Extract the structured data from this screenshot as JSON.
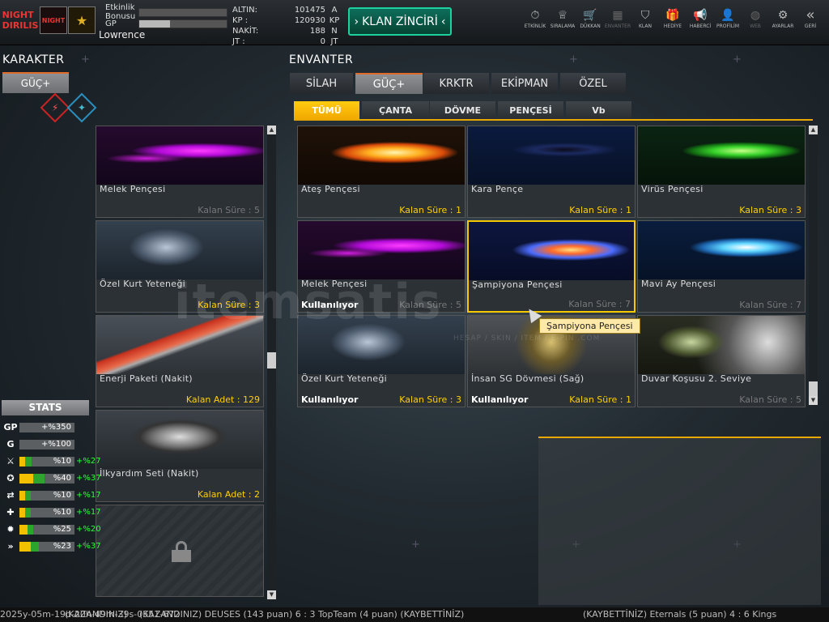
{
  "topbar": {
    "logos": [
      "NIGHT\nDIRILIS",
      "NIGHT",
      "★"
    ],
    "bonus_label": "Etkinlik\nBonusu",
    "gp_label": "GP",
    "player_name": "Lowrence",
    "bonus_progress": 0,
    "gp_progress": 0.35,
    "currencies": [
      {
        "label": "ALTIN:",
        "value": "101475",
        "unit": "A"
      },
      {
        "label": "KP :",
        "value": "120930",
        "unit": "KP"
      },
      {
        "label": "NAKİT:",
        "value": "188",
        "unit": "N"
      },
      {
        "label": "JT :",
        "value": "0",
        "unit": "JT"
      }
    ],
    "klan_button": "KLAN ZİNCİRİ",
    "menu": [
      {
        "label": "ETKİNLİK",
        "icon": "stopwatch-icon",
        "glyph": "⏱",
        "dim": false
      },
      {
        "label": "SIRALAMA",
        "icon": "medal-icon",
        "glyph": "♕",
        "dim": false
      },
      {
        "label": "DÜKKAN",
        "icon": "cart-icon",
        "glyph": "🛒",
        "dim": false
      },
      {
        "label": "ENVANTER",
        "icon": "inventory-icon",
        "glyph": "▦",
        "dim": true
      },
      {
        "label": "KLAN",
        "icon": "shield-icon",
        "glyph": "⛉",
        "dim": false
      },
      {
        "label": "HEDİYE",
        "icon": "gift-icon",
        "glyph": "🎁",
        "dim": false
      },
      {
        "label": "HABERCİ",
        "icon": "megaphone-icon",
        "glyph": "📢",
        "dim": false
      },
      {
        "label": "PROFİLİM",
        "icon": "profile-icon",
        "glyph": "👤",
        "dim": false
      },
      {
        "label": "WEB",
        "icon": "globe-icon",
        "glyph": "◍",
        "dim": true
      },
      {
        "label": "AYARLAR",
        "icon": "gear-icon",
        "glyph": "⚙",
        "dim": false
      },
      {
        "label": "GERİ",
        "icon": "back-chevrons-icon",
        "glyph": "«",
        "dim": false
      }
    ]
  },
  "left": {
    "title": "KARAKTER",
    "active_tab": "GÜÇ+",
    "class_icons": [
      "⚡",
      "✦"
    ],
    "cards": [
      {
        "name": "Melek Pençesi",
        "bottom": "Kalan Süre : 5",
        "tone": "gray",
        "art": "magenta"
      },
      {
        "name": "Özel Kurt Yeteneği",
        "bottom": "Kalan Süre : 3",
        "tone": "yellow",
        "art": "wolf"
      },
      {
        "name": "Enerji Paketi (Nakit)",
        "bottom": "Kalan Adet : 129",
        "tone": "yellow",
        "art": "syringe"
      },
      {
        "name": "İlkyardım Seti (Nakit)",
        "bottom": "Kalan Adet : 2",
        "tone": "yellow",
        "art": "medkit"
      }
    ],
    "locked_icon": "padlock-icon"
  },
  "stats": {
    "title": "STATS",
    "rows": [
      {
        "icon": "GP",
        "value": "+%350",
        "bonus": "",
        "yellow": 0,
        "green": 0
      },
      {
        "icon": "G",
        "value": "+%100",
        "bonus": "",
        "yellow": 0,
        "green": 0
      },
      {
        "icon": "⚔",
        "value": "%10",
        "bonus": "+%27",
        "yellow": 0.1,
        "green": 0.12
      },
      {
        "icon": "✪",
        "value": "%40",
        "bonus": "+%37",
        "yellow": 0.25,
        "green": 0.2
      },
      {
        "icon": "⇄",
        "value": "%10",
        "bonus": "+%17",
        "yellow": 0.1,
        "green": 0.1
      },
      {
        "icon": "✚",
        "value": "%10",
        "bonus": "+%17",
        "yellow": 0.1,
        "green": 0.1
      },
      {
        "icon": "✹",
        "value": "%25",
        "bonus": "+%20",
        "yellow": 0.15,
        "green": 0.1
      },
      {
        "icon": "»",
        "value": "%23",
        "bonus": "+%37",
        "yellow": 0.2,
        "green": 0.15
      }
    ]
  },
  "inventory": {
    "title": "ENVANTER",
    "tabs": [
      "SİLAH",
      "GÜÇ+",
      "KRKTR",
      "EKİPMAN",
      "ÖZEL"
    ],
    "subtabs": [
      "TÜMÜ",
      "ÇANTA",
      "DÖVME",
      "PENÇESİ",
      "Vb"
    ],
    "items": [
      {
        "name": "Ateş Pençesi",
        "status": "",
        "bottom": "Kalan Süre : 1",
        "tone": "yellow",
        "art": "fire",
        "selected": false
      },
      {
        "name": "Kara Pençe",
        "status": "",
        "bottom": "Kalan Süre : 1",
        "tone": "yellow",
        "art": "dark",
        "selected": false
      },
      {
        "name": "Virüs Pençesi",
        "status": "",
        "bottom": "Kalan Süre : 3",
        "tone": "yellow",
        "art": "green",
        "selected": false
      },
      {
        "name": "Melek Pençesi",
        "status": "Kullanılıyor",
        "bottom": "Kalan Süre : 5",
        "tone": "gray",
        "art": "magenta",
        "selected": false
      },
      {
        "name": "Şampiyona Pençesi",
        "status": "",
        "bottom": "Kalan Süre : 7",
        "tone": "gray",
        "art": "flame-blue",
        "selected": true
      },
      {
        "name": "Mavi Ay Pençesi",
        "status": "",
        "bottom": "Kalan Süre : 7",
        "tone": "gray",
        "art": "cyan",
        "selected": false
      },
      {
        "name": "Özel Kurt Yeteneği",
        "status": "Kullanılıyor",
        "bottom": "Kalan Süre : 3",
        "tone": "yellow",
        "art": "wolf",
        "selected": false
      },
      {
        "name": "İnsan SG Dövmesi (Sağ)",
        "status": "Kullanılıyor",
        "bottom": "Kalan Süre : 1",
        "tone": "yellow",
        "art": "tattoo",
        "selected": false
      },
      {
        "name": "Duvar Koşusu 2. Seviye",
        "status": "",
        "bottom": "Kalan Süre : 5",
        "tone": "gray",
        "art": "wallrun",
        "selected": false
      }
    ],
    "tooltip": "Şampiyona Pençesi"
  },
  "ticker": {
    "left": "2025y-05m-19d-20h-49m-39s-0551-672",
    "mid": "(KAZANDINIZ) DEUSES (143 puan) 6 : 3 TopTeam (4 puan) (KAYBETTİNİZ)",
    "right": "(KAYBETTİNİZ) Eternals (5 puan) 4 : 6 Kings",
    "prefix": "(KAZANDINIZ)"
  },
  "watermark": {
    "main": "itemsatis",
    "sub": "HESAP / SKIN / ITEM / E-PIN .COM"
  },
  "colors": {
    "accent": "#f2c000",
    "klan": "#1dd19e",
    "bonus_green": "#2bff3a"
  }
}
